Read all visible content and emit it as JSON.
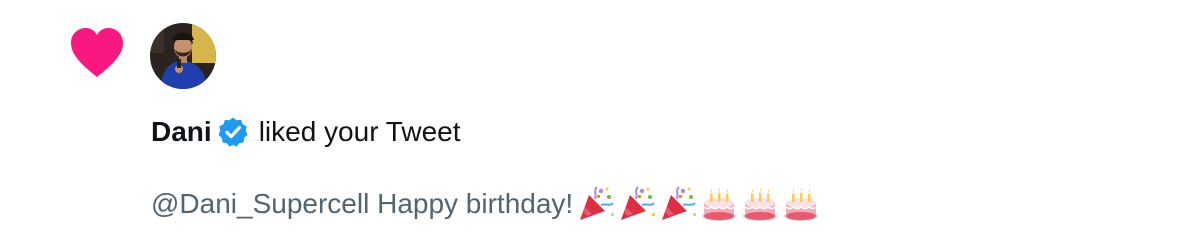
{
  "notification": {
    "type_icon": "heart-icon",
    "user": {
      "name": "Dani",
      "verified_icon": "verified-badge-icon",
      "avatar_icon": "avatar"
    },
    "action_text": "liked your Tweet",
    "tweet": {
      "text": "@Dani_Supercell Happy birthday!",
      "emojis": [
        "party-popper-icon",
        "party-popper-icon",
        "party-popper-icon",
        "birthday-cake-icon",
        "birthday-cake-icon",
        "birthday-cake-icon"
      ]
    }
  },
  "colors": {
    "heart": "#f91880",
    "verified": "#1d9bf0",
    "primary_text": "#0f1419",
    "secondary_text": "#536471"
  }
}
